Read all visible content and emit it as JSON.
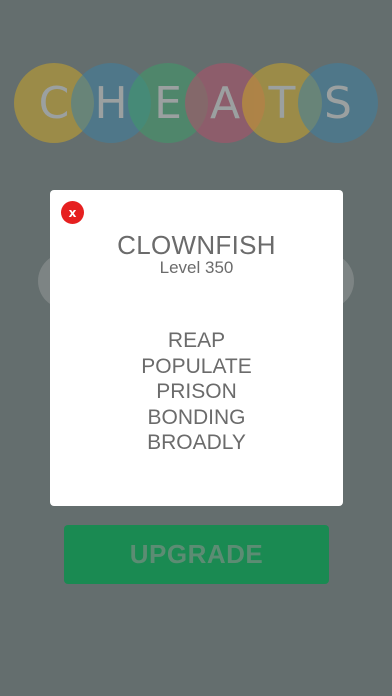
{
  "logo": {
    "letters": [
      {
        "char": "C",
        "color": "#c9a32a"
      },
      {
        "char": "H",
        "color": "#3f7fa0"
      },
      {
        "char": "E",
        "color": "#3f9b6a"
      },
      {
        "char": "A",
        "color": "#b0506a"
      },
      {
        "char": "T",
        "color": "#c9a32a"
      },
      {
        "char": "S",
        "color": "#3f7fa0"
      }
    ]
  },
  "modal": {
    "close_icon": "close-icon",
    "close_symbol": "x",
    "title": "CLOWNFISH",
    "level": "Level 350",
    "answers": [
      "REAP",
      "POPULATE",
      "PRISON",
      "BONDING",
      "BROADLY"
    ]
  },
  "upgrade": {
    "label": "UPGRADE"
  },
  "colors": {
    "overlay_bg": "#646e6e",
    "modal_bg": "#ffffff",
    "close_red": "#e62020",
    "upgrade_green": "#1a8a52"
  }
}
